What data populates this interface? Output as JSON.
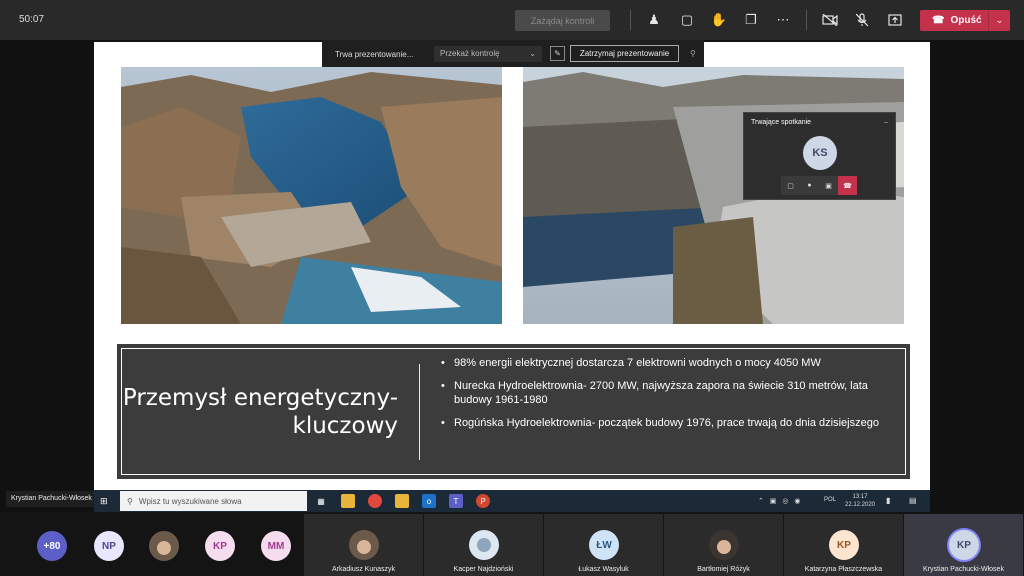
{
  "topbar": {
    "timer": "50:07",
    "request_control": "Zażądaj kontroli",
    "leave_label": "Opuść",
    "icons": [
      "participants-icon",
      "chat-icon",
      "raise-hand-icon",
      "rooms-icon",
      "more-icon",
      "camera-off-icon",
      "mic-off-icon",
      "share-icon",
      "phone-icon"
    ]
  },
  "presenting_bar": {
    "status": "Trwa prezentowanie...",
    "give_control": "Przekaż kontrolę",
    "stop_presenting": "Zatrzymaj prezentowanie"
  },
  "mini_meeting": {
    "title": "Trwające spotkanie",
    "avatar_initials": "KS"
  },
  "slide": {
    "title_line1": "Przemysł energetyczny-",
    "title_line2": "kluczowy",
    "bullets": [
      "98% energii elektrycznej dostarcza 7 elektrowni wodnych o mocy 4050 MW",
      "Nurecka Hydroelektrownia- 2700 MW, najwyższa zapora na świecie 310 metrów, lata budowy 1961-1980",
      "Rogúńska Hydroelektrownia- początek budowy 1976, prace trwają do dnia dzisiejszego"
    ]
  },
  "presenter_label": "Krystian Pachucki-Włosek",
  "taskbar": {
    "search_placeholder": "Wpisz tu wyszukiwane słowa",
    "tray_lang": "POL",
    "time": "13:17",
    "date": "22.12.2020"
  },
  "participants": {
    "overflow": "+80",
    "small": [
      {
        "initials": "NP",
        "bg": "#e9e6ff",
        "fg": "#4b4a8c"
      },
      {
        "initials": "",
        "bg": "#6b5a4a",
        "fg": "#fff"
      },
      {
        "initials": "KP",
        "bg": "#f6dcef",
        "fg": "#a03c8c"
      },
      {
        "initials": "MM",
        "bg": "#f6dcef",
        "fg": "#a03c8c"
      }
    ],
    "tiles": [
      {
        "name": "Arkadiusz Kunaszyk",
        "initials": "",
        "bg": "#5b4b3e",
        "fg": "#fff"
      },
      {
        "name": "Kacper Najdzioński",
        "initials": "",
        "bg": "#dde7f2",
        "fg": "#333"
      },
      {
        "name": "Łukasz Wasyluk",
        "initials": "ŁW",
        "bg": "#cfe3f7",
        "fg": "#2f5a86"
      },
      {
        "name": "Bartłomiej Różyk",
        "initials": "",
        "bg": "#3b3430",
        "fg": "#fff"
      },
      {
        "name": "Katarzyna Płaszczewska",
        "initials": "KP",
        "bg": "#fde5cf",
        "fg": "#9a5420"
      },
      {
        "name": "Krystian Pachucki-Włosek",
        "initials": "KP",
        "bg": "#ced7e6",
        "fg": "#3d4b6a"
      }
    ]
  }
}
